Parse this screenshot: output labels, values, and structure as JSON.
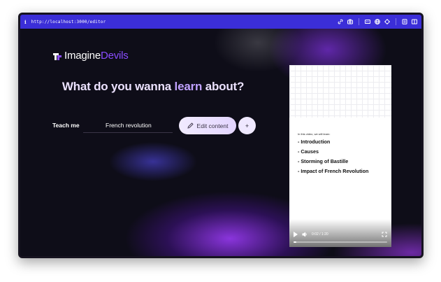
{
  "browser": {
    "url": "http://localhost:3000/editor",
    "info_glyph": "i",
    "toolbar_icons": [
      "link-icon",
      "camera-icon",
      "caption-icon",
      "globe-icon",
      "crosshair-icon",
      "layers-icon",
      "panel-icon"
    ]
  },
  "brand": {
    "name_part1": "Imagine",
    "name_part2": "Devils",
    "accent_color": "#8a4dff"
  },
  "headline": {
    "prefix": "What do you wanna ",
    "highlight": "learn",
    "suffix": " about?"
  },
  "form": {
    "label": "Teach me",
    "topic_value": "French revolution",
    "edit_button_label": "Edit content",
    "add_button_label": "+"
  },
  "video": {
    "intro_text": "In this video, we will learn:",
    "bullets": [
      "- Introduction",
      "- Causes",
      "- Storming of Bastille",
      "- Impact of French Revolution"
    ],
    "time_display": "0:02 / 1:20",
    "progress": 0.03
  }
}
